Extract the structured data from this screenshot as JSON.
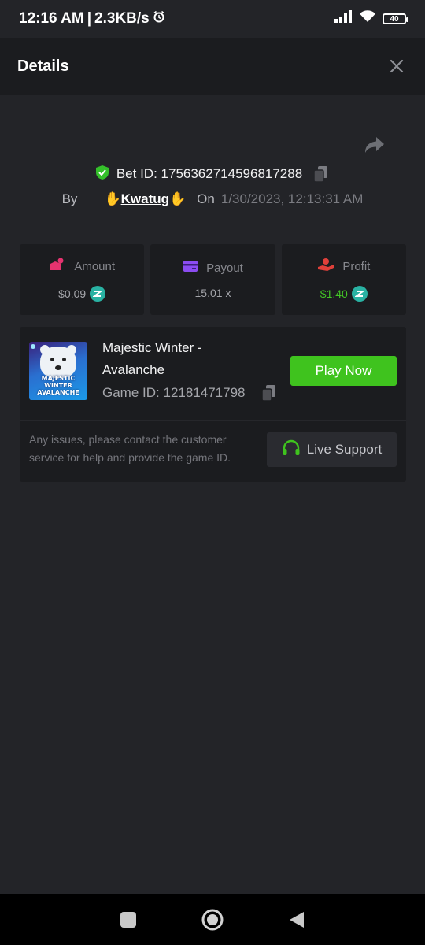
{
  "status_bar": {
    "time": "12:16 AM",
    "separator": "|",
    "speed": "2.3KB/s",
    "battery": "40"
  },
  "header": {
    "title": "Details"
  },
  "bet": {
    "id_label": "Bet ID:",
    "id_value": "1756362714596817288",
    "by_label": "By",
    "user": "Kwatug",
    "on_label": "On",
    "datetime": "1/30/2023, 12:13:31 AM"
  },
  "stats": {
    "amount_label": "Amount",
    "amount_value": "$0.09",
    "payout_label": "Payout",
    "payout_value": "15.01 x",
    "profit_label": "Profit",
    "profit_value": "$1.40"
  },
  "game": {
    "thumbnail_text": "MAJESTIC WINTER AVALANCHE",
    "name": "Majestic Winter - Avalanche",
    "id_label": "Game ID:",
    "id_value": "12181471798",
    "play_label": "Play Now",
    "help_text": "Any issues, please contact the customer service for help and provide the game ID.",
    "support_label": "Live Support"
  },
  "colors": {
    "background": "#232428",
    "panel": "#1b1c1f",
    "accent_green": "#3fc31e",
    "profit_green": "#43c626",
    "coin_teal": "#29b2a3",
    "amount_pink": "#e6336f",
    "payout_purple": "#8b4cf0",
    "profit_red": "#e0403a"
  }
}
